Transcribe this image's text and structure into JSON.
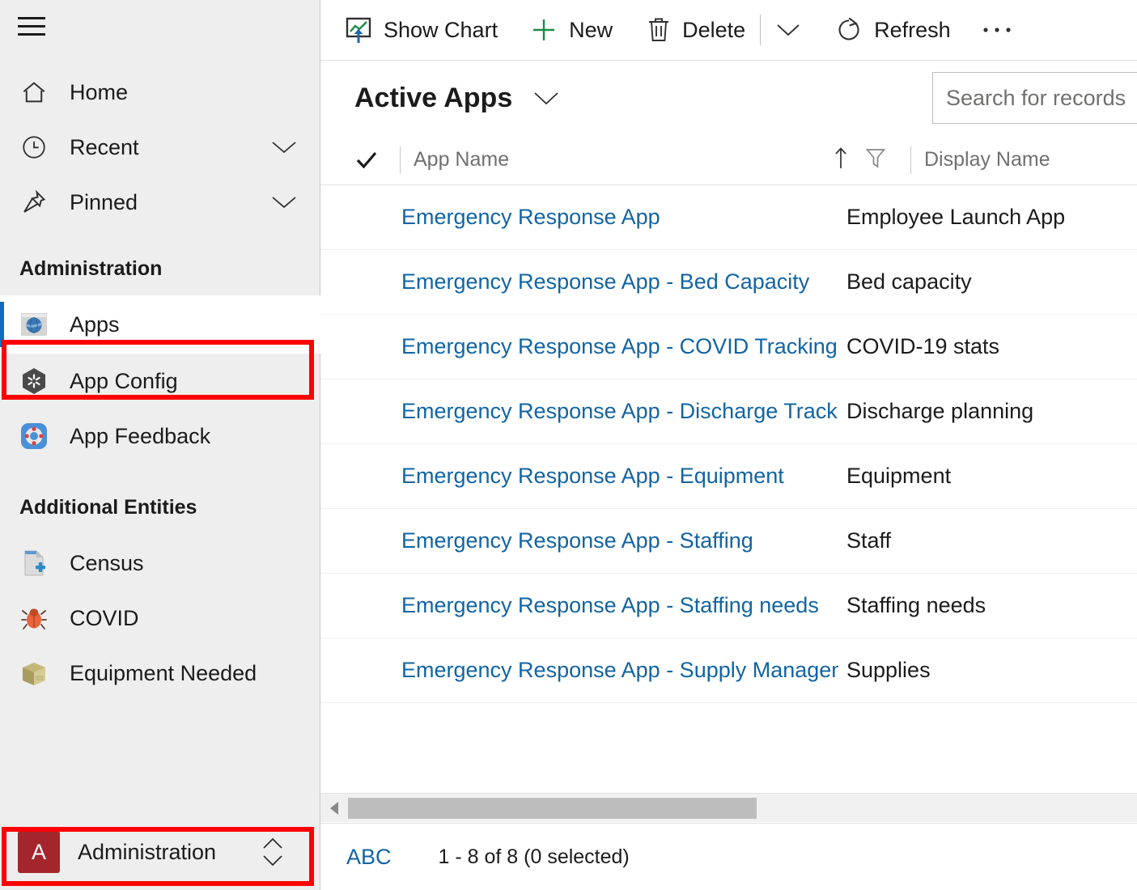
{
  "sidebar": {
    "hamburger_label": "menu-icon",
    "nav": [
      {
        "label": "Home",
        "icon": "home-icon",
        "chevron": false
      },
      {
        "label": "Recent",
        "icon": "clock-icon",
        "chevron": true
      },
      {
        "label": "Pinned",
        "icon": "pin-icon",
        "chevron": true
      }
    ],
    "groups": [
      {
        "title": "Administration",
        "items": [
          {
            "label": "Apps",
            "icon": "globe-icon",
            "selected": true
          },
          {
            "label": "App Config",
            "icon": "hexagon-gear-icon",
            "selected": false
          },
          {
            "label": "App Feedback",
            "icon": "lifebuoy-icon",
            "selected": false
          }
        ]
      },
      {
        "title": "Additional Entities",
        "items": [
          {
            "label": "Census",
            "icon": "document-plus-icon",
            "selected": false
          },
          {
            "label": "COVID",
            "icon": "bug-icon",
            "selected": false
          },
          {
            "label": "Equipment Needed",
            "icon": "box-icon",
            "selected": false
          }
        ]
      }
    ],
    "app_switcher": {
      "badge": "A",
      "name": "Administration",
      "toggle_icon": "up-down-chevron-icon"
    }
  },
  "commandbar": {
    "buttons": [
      {
        "label": "Show Chart",
        "icon": "chart-icon"
      },
      {
        "label": "New",
        "icon": "plus-icon"
      },
      {
        "label": "Delete",
        "icon": "trash-icon"
      }
    ],
    "more_chevron_icon": "chevron-down-icon",
    "refresh": {
      "label": "Refresh",
      "icon": "refresh-icon"
    },
    "overflow_icon": "ellipsis-icon"
  },
  "view": {
    "title": "Active Apps",
    "title_chevron_icon": "chevron-down-icon"
  },
  "search": {
    "placeholder": "Search for records",
    "value": ""
  },
  "grid": {
    "select_all_icon": "checkmark-icon",
    "columns": [
      {
        "label": "App Name",
        "sort_icon": "sort-asc-icon",
        "filter_icon": "filter-icon"
      },
      {
        "label": "Display Name"
      }
    ],
    "rows": [
      {
        "app_name": "Emergency Response App",
        "display_name": "Employee Launch App"
      },
      {
        "app_name": "Emergency Response App - Bed Capacity",
        "display_name": "Bed capacity"
      },
      {
        "app_name": "Emergency Response App - COVID Tracking",
        "display_name": "COVID-19 stats"
      },
      {
        "app_name": "Emergency Response App - Discharge Tracking.",
        "display_name": "Discharge planning"
      },
      {
        "app_name": "Emergency Response App - Equipment",
        "display_name": "Equipment"
      },
      {
        "app_name": "Emergency Response App - Staffing",
        "display_name": "Staff"
      },
      {
        "app_name": "Emergency Response App - Staffing needs",
        "display_name": "Staffing needs"
      },
      {
        "app_name": "Emergency Response App - Supply Management",
        "display_name": "Supplies"
      }
    ]
  },
  "scrollbar": {
    "left_arrow_icon": "caret-left-icon"
  },
  "footer": {
    "index_label": "ABC",
    "record_count": "1 - 8 of 8 (0 selected)"
  },
  "annotations": {
    "highlight_color": "#ff0000",
    "boxes": [
      {
        "target": "sidebar-item-apps"
      },
      {
        "target": "app-switcher"
      }
    ]
  },
  "colors": {
    "link": "#1264a3",
    "sidebar_bg": "#eeeeee",
    "selection_bar": "#0f6cbd",
    "app_badge": "#a4262c"
  }
}
